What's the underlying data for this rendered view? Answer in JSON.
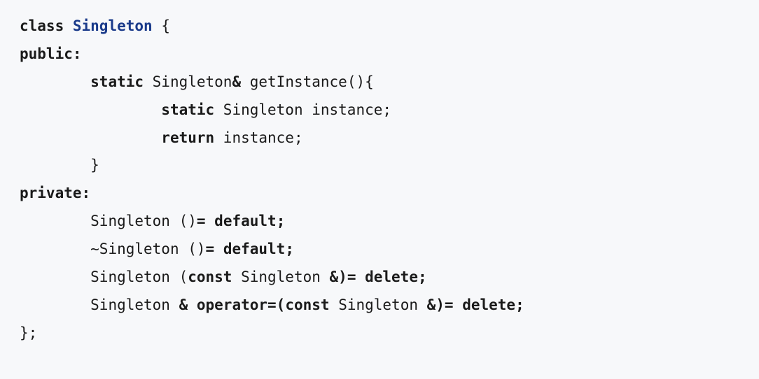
{
  "code": {
    "kw_class": "class",
    "class_name": "Singleton",
    "brace_open": " {",
    "kw_public": "public",
    "colon1": ":",
    "kw_static1": "static",
    "ret_type": " Singleton",
    "amp1": "& ",
    "fn_name": "getInstance(){",
    "kw_static2": "static",
    "instance_decl": " Singleton instance;",
    "kw_return": "return",
    "return_val": " instance;",
    "fn_close": "}",
    "kw_private": "private",
    "colon2": ":",
    "ctor": "Singleton ()",
    "eq1": "= ",
    "kw_default1": "default",
    "semi1": ";",
    "dtor": "~Singleton ()",
    "eq2": "= ",
    "kw_default2": "default",
    "semi2": ";",
    "copy_ctor_pre": "Singleton (",
    "kw_const1": "const",
    "copy_ctor_mid": " Singleton ",
    "amp_close1": "&)= ",
    "kw_delete1": "delete",
    "semi3": ";",
    "assign_pre": "Singleton ",
    "amp_op": "& operator=",
    "paren_open": "(",
    "kw_const2": "const",
    "assign_mid": " Singleton ",
    "amp_close2": "&)= ",
    "kw_delete2": "delete",
    "semi4": ";",
    "class_close": "};"
  }
}
